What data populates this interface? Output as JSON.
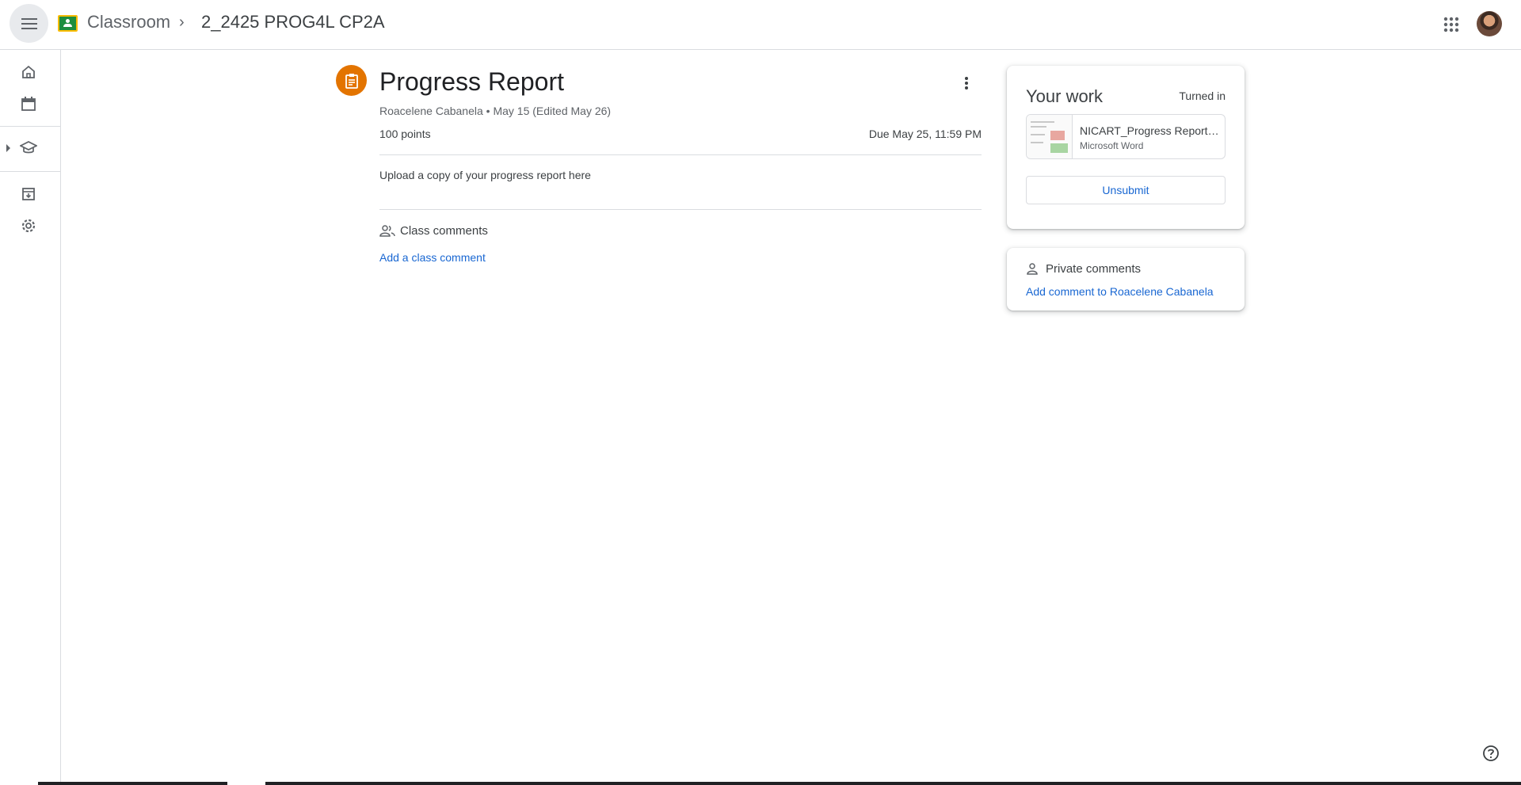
{
  "header": {
    "app_name": "Classroom",
    "breadcrumb_separator": "›",
    "course_name": "2_2425 PROG4L CP2A",
    "menu_icon": "hamburger-menu-icon",
    "apps_icon": "google-apps-grid-icon",
    "brand_color": "#1e8e3e"
  },
  "sidebar": {
    "items": [
      {
        "name": "home",
        "icon": "home-icon"
      },
      {
        "name": "calendar",
        "icon": "calendar-icon"
      },
      {
        "name": "enrolled",
        "icon": "graduation-cap-icon"
      },
      {
        "name": "to-do",
        "icon": "archive-icon"
      },
      {
        "name": "settings",
        "icon": "gear-icon"
      }
    ]
  },
  "assignment": {
    "title": "Progress Report",
    "meta": "Roacelene Cabanela • May 15 (Edited May 26)",
    "points": "100 points",
    "due": "Due May 25, 11:59 PM",
    "instructions": "Upload a copy of your progress report here",
    "accent_color": "#e37400"
  },
  "class_comments": {
    "label": "Class comments",
    "add_link": "Add a class comment"
  },
  "your_work": {
    "title": "Your work",
    "status": "Turned in",
    "file_name": "NICART_Progress Report.docx",
    "file_type": "Microsoft Word",
    "unsubmit_label": "Unsubmit"
  },
  "private_comments": {
    "label": "Private comments",
    "add_link": "Add comment to Roacelene Cabanela"
  },
  "link_color": "#1967d2"
}
